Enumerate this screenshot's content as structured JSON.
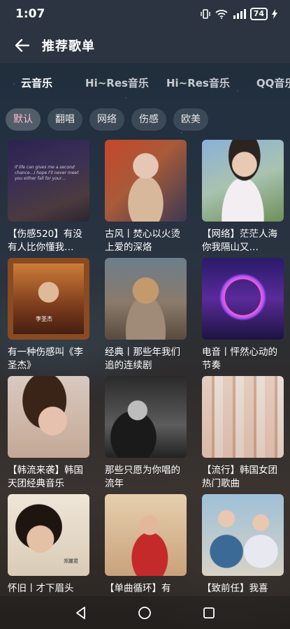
{
  "status_bar": {
    "time": "1:07",
    "battery": "74"
  },
  "header": {
    "title": "推荐歌单"
  },
  "tabs": [
    "云音乐",
    "Hi~Res音乐",
    "Hi~Res音乐",
    "QQ音乐"
  ],
  "chips": [
    "默认",
    "翻唱",
    "网络",
    "伤感",
    "欧美"
  ],
  "playlists": [
    {
      "title": "【伤感520】有没有人比你懂我…",
      "cover_text": "If life can gives me a second chance…I hope I'll never meet you either fall for your…"
    },
    {
      "title": "古风丨焚心以火烫上爱的深烙"
    },
    {
      "title": "【网络】茫茫人海 你我隔山又…"
    },
    {
      "title": "有一种伤感叫《李圣杰》",
      "cover_text": "李圣杰"
    },
    {
      "title": "经典丨那些年我们追的连续剧"
    },
    {
      "title": "电音丨怦然心动的节奏"
    },
    {
      "title": "【韩流来袭】韩国天团经典音乐"
    },
    {
      "title": "那些只愿为你唱的流年"
    },
    {
      "title": "【流行】韩国女团热门歌曲"
    },
    {
      "title": "怀旧丨才下眉头",
      "cover_text": "郑麗君"
    },
    {
      "title": "【单曲循环】有"
    },
    {
      "title": "【致前任】我喜"
    }
  ],
  "colors": {
    "accent_chip_text": "#ffbfd0",
    "header_bg": "#2b3440"
  }
}
